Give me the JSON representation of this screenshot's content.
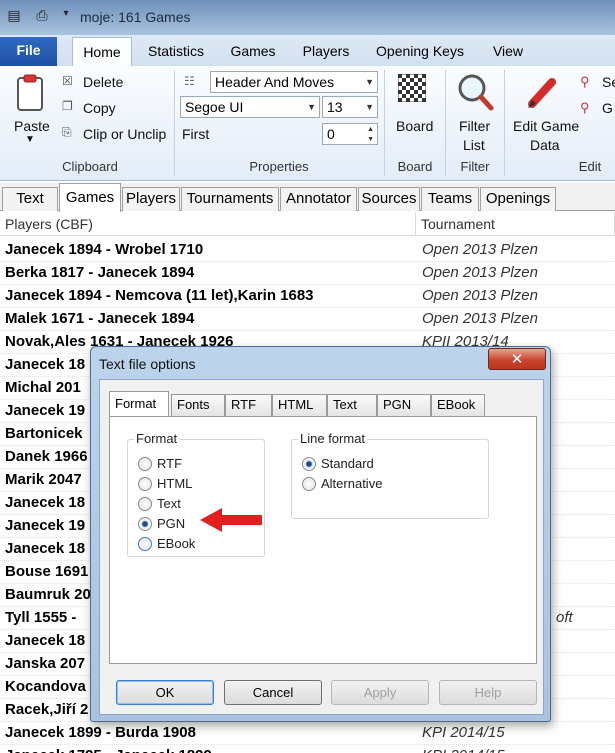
{
  "app": {
    "title": "moje:  161 Games"
  },
  "ribbon_tabs": {
    "file": "File",
    "tabs": [
      "Home",
      "Statistics",
      "Games",
      "Players",
      "Opening Keys",
      "View"
    ]
  },
  "clipboard": {
    "paste": "Paste",
    "delete": "Delete",
    "copy": "Copy",
    "clip": "Clip or Unclip",
    "group": "Clipboard"
  },
  "properties": {
    "layout": "Header And Moves",
    "font": "Segoe UI",
    "size": "13",
    "first_label": "First",
    "first_value": "0",
    "group": "Properties"
  },
  "board": {
    "label": "Board",
    "group": "Board"
  },
  "filter": {
    "label1": "Filter",
    "label2": "List",
    "group": "Filter"
  },
  "edit": {
    "label1": "Edit Game",
    "label2": "Data",
    "group": "Edit",
    "side1": "Se",
    "side2": "G"
  },
  "doc_tabs": [
    "Text",
    "Games",
    "Players",
    "Tournaments",
    "Annotator",
    "Sources",
    "Teams",
    "Openings"
  ],
  "list": {
    "headers": {
      "players": "Players (CBF)",
      "tournament": "Tournament"
    },
    "rows": [
      {
        "players": "Janecek 1894 - Wrobel 1710",
        "tournament": "Open 2013 Plzen"
      },
      {
        "players": "Berka 1817 - Janecek 1894",
        "tournament": "Open 2013 Plzen"
      },
      {
        "players": "Janecek 1894 - Nemcova (11 let),Karin 1683",
        "tournament": "Open 2013 Plzen"
      },
      {
        "players": "Malek 1671 - Janecek 1894",
        "tournament": "Open 2013 Plzen"
      },
      {
        "players": "Novak,Ales 1631 - Janecek 1926",
        "tournament": "KPII 2013/14"
      },
      {
        "players": "Janecek 18",
        "tournament": ""
      },
      {
        "players": "Michal 201",
        "tournament": ""
      },
      {
        "players": "Janecek 19",
        "tournament": ""
      },
      {
        "players": "Bartonicek",
        "tournament": ""
      },
      {
        "players": "Danek 1966",
        "tournament": ""
      },
      {
        "players": "Marik 2047",
        "tournament": ""
      },
      {
        "players": "Janecek 18",
        "tournament": ""
      },
      {
        "players": "Janecek 19",
        "tournament": ""
      },
      {
        "players": "Janecek 18",
        "tournament": ""
      },
      {
        "players": "Bouse 1691",
        "tournament": ""
      },
      {
        "players": "Baumruk 20",
        "tournament": ""
      },
      {
        "players": "Tyll 1555 -",
        "tournament": "oft"
      },
      {
        "players": "Janecek 18",
        "tournament": ""
      },
      {
        "players": "Janska 207",
        "tournament": ""
      },
      {
        "players": "Kocandova",
        "tournament": ""
      },
      {
        "players": "Racek,Jiří 2",
        "tournament": ""
      },
      {
        "players": "Janecek 1899 - Burda 1908",
        "tournament": "KPI 2014/15"
      },
      {
        "players": "Janecek 1795 - Janecek 1899",
        "tournament": "KPI 2014/15"
      }
    ]
  },
  "dialog": {
    "title": "Text file options",
    "close": "✕",
    "tabs": [
      "Format",
      "Fonts",
      "RTF",
      "HTML",
      "Text",
      "PGN",
      "EBook"
    ],
    "format_group": "Format",
    "format_options": [
      "RTF",
      "HTML",
      "Text",
      "PGN",
      "EBook"
    ],
    "line_group": "Line format",
    "line_options": [
      "Standard",
      "Alternative"
    ],
    "buttons": {
      "ok": "OK",
      "cancel": "Cancel",
      "apply": "Apply",
      "help": "Help"
    }
  }
}
